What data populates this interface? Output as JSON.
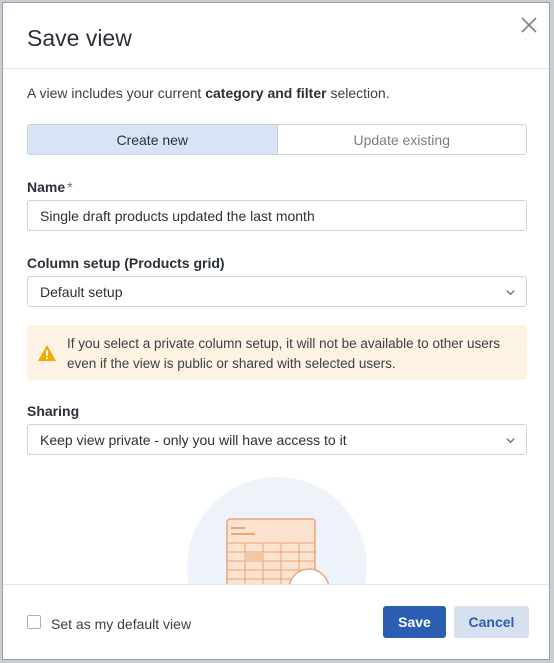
{
  "dialog": {
    "title": "Save view",
    "intro_prefix": "A view includes your current ",
    "intro_bold": "category and filter",
    "intro_suffix": " selection."
  },
  "tabs": [
    {
      "label": "Create new",
      "active": true
    },
    {
      "label": "Update existing",
      "active": false
    }
  ],
  "name_field": {
    "label": "Name",
    "required_marker": "*",
    "value": "Single draft products updated the last month"
  },
  "column_setup": {
    "label": "Column setup (Products grid)",
    "selected": "Default setup"
  },
  "warning": {
    "text": "If you select a private column setup, it will not be available to other users even if the view is public or shared with selected users."
  },
  "sharing": {
    "label": "Sharing",
    "selected": "Keep view private - only you will have access to it"
  },
  "footer": {
    "default_checkbox_label": "Set as my default view",
    "default_checked": false,
    "save_label": "Save",
    "cancel_label": "Cancel"
  },
  "colors": {
    "primary": "#2b5db2",
    "tab_active_bg": "#d8e3f5",
    "warning_bg": "#fdf3e2",
    "warning_icon": "#f2a900"
  },
  "icons": {
    "close": "close-icon",
    "chevron": "chevron-down-icon",
    "warning": "warning-icon"
  }
}
